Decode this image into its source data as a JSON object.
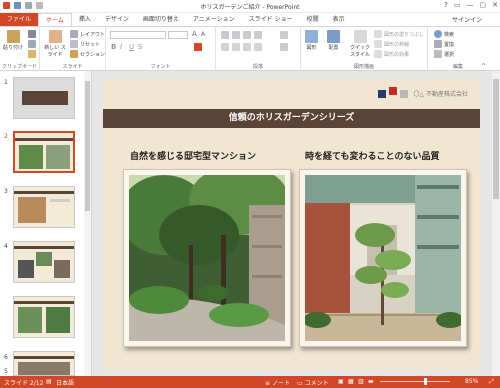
{
  "window": {
    "title": "ホリスガーデンご紹介 - PowerPoint",
    "controls": [
      "?",
      "▭",
      "—",
      "▢",
      "✕"
    ]
  },
  "tabs": [
    {
      "label": "ファイル"
    },
    {
      "label": "ホーム"
    },
    {
      "label": "挿入"
    },
    {
      "label": "デザイン"
    },
    {
      "label": "画面切り替え"
    },
    {
      "label": "アニメーション"
    },
    {
      "label": "スライド ショー"
    },
    {
      "label": "校閲"
    },
    {
      "label": "表示"
    }
  ],
  "signin": "サインイン",
  "ribbon": {
    "clipboard": {
      "label": "クリップボード",
      "paste": "貼り付け"
    },
    "slides": {
      "label": "スライド",
      "new_slide": "新しい スライド",
      "layout": "レイアウト",
      "reset": "リセット",
      "section": "セクション"
    },
    "font": {
      "label": "フォント"
    },
    "paragraph": {
      "label": "段落"
    },
    "drawing": {
      "label": "図形描画",
      "shapes": "図形",
      "arrange": "配置",
      "quick_styles": "クイック スタイル",
      "fill": "図形の塗りつぶし",
      "outline": "図形の枠線",
      "effects": "図形の効果"
    },
    "editing": {
      "label": "編集",
      "find": "検索",
      "replace": "置換",
      "select": "選択"
    }
  },
  "thumbnails": [
    {
      "num": "1"
    },
    {
      "num": "2"
    },
    {
      "num": "3"
    },
    {
      "num": "4"
    },
    {
      "num": "5"
    },
    {
      "num": "6"
    }
  ],
  "slide": {
    "logo": "〇△ 不動産株式会社",
    "banner": "信頼のホリスガーデンシリーズ",
    "left_caption": "自然を感じる邸宅型マンション",
    "right_caption": "時を経ても変わることのない品質"
  },
  "status": {
    "slide": "スライド 2/12",
    "language": "日本語",
    "notes": "ノート",
    "comments": "コメント",
    "zoom": "85%",
    "zoom_level": 0.85
  },
  "colors": {
    "accent": "#d24726",
    "banner": "#5a4337",
    "slide_bg": "#f1e6d1"
  }
}
